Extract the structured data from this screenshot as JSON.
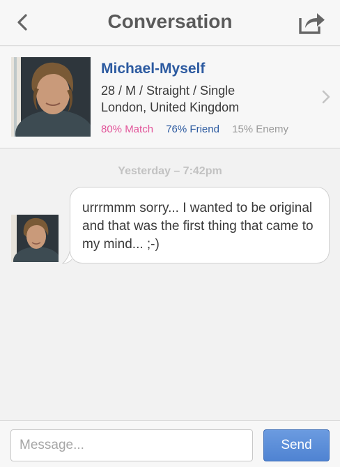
{
  "header": {
    "title": "Conversation",
    "back_icon": "chevron-left-icon",
    "share_icon": "share-icon"
  },
  "profile": {
    "name": "Michael-Myself",
    "details": "28 / M / Straight / Single",
    "location": "London, United Kingdom",
    "match": "80% Match",
    "friend": "76% Friend",
    "enemy": "15% Enemy"
  },
  "conversation": {
    "timestamp": "Yesterday – 7:42pm",
    "messages": [
      {
        "text": "urrrmmm sorry... I wanted to be original and that was the first thing that came to my mind... ;-)"
      }
    ]
  },
  "composer": {
    "placeholder": "Message...",
    "send_label": "Send"
  },
  "colors": {
    "accent": "#2c5aa0",
    "match": "#e2559a",
    "send": "#5b8fd8"
  }
}
